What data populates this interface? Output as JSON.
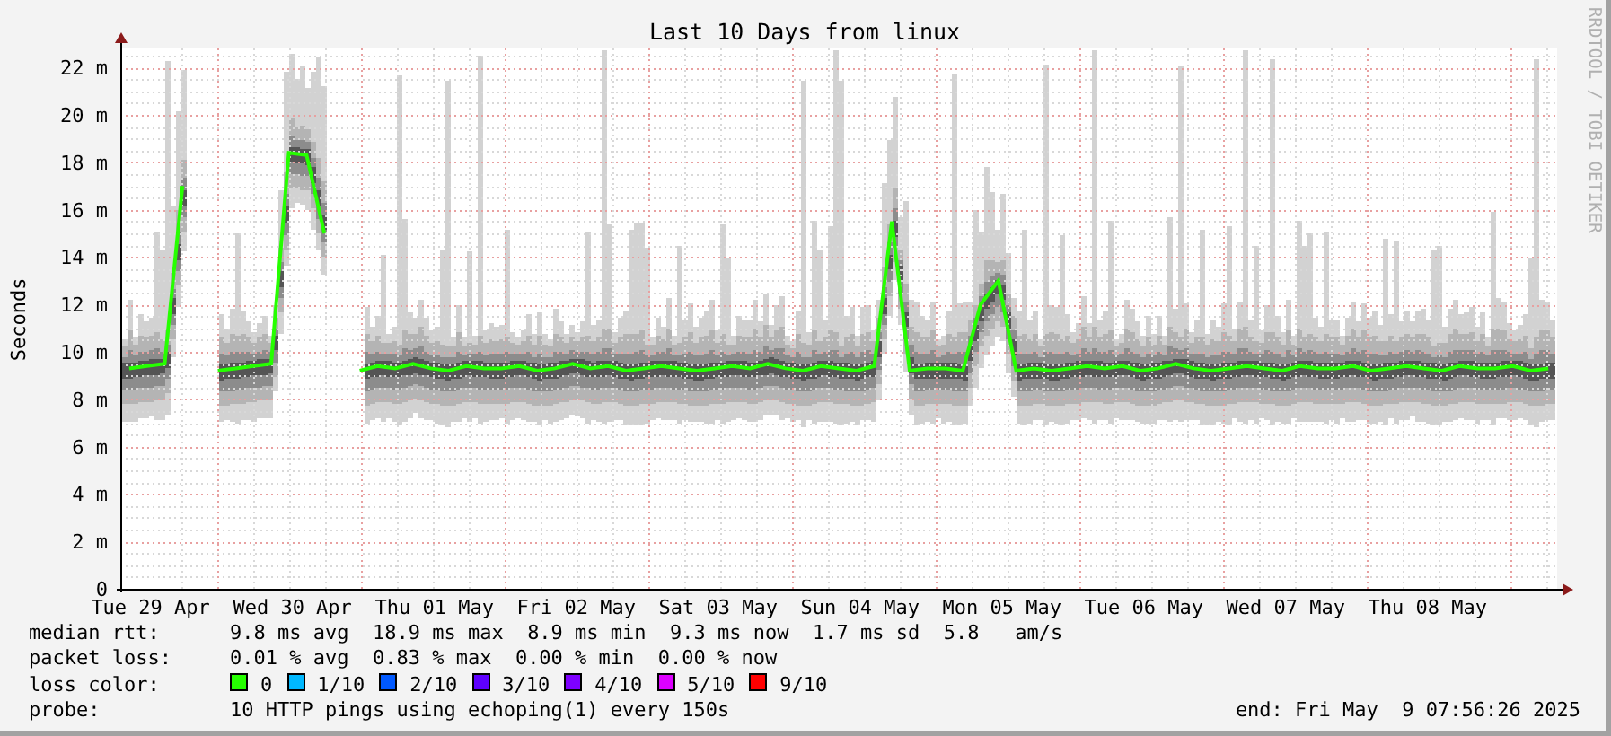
{
  "graph": {
    "credit": "RRDTOOL / TOBI OETIKER",
    "chart_data": {
      "type": "line",
      "title": "Last 10 Days from linux",
      "ylabel": "Seconds",
      "categories": [
        null,
        "Tue 29 Apr",
        null,
        null,
        null,
        null,
        null,
        null,
        null,
        "Wed 30 Apr",
        null,
        null,
        null,
        null,
        null,
        null,
        null,
        "Thu 01 May",
        null,
        null,
        null,
        null,
        null,
        null,
        null,
        "Fri 02 May",
        null,
        null,
        null,
        null,
        null,
        null,
        null,
        "Sat 03 May",
        null,
        null,
        null,
        null,
        null,
        null,
        null,
        "Sun 04 May",
        null,
        null,
        null,
        null,
        null,
        null,
        null,
        "Mon 05 May",
        null,
        null,
        null,
        null,
        null,
        null,
        null,
        "Tue 06 May",
        null,
        null,
        null,
        null,
        null,
        null,
        null,
        "Wed 07 May",
        null,
        null,
        null,
        null,
        null,
        null,
        null,
        "Thu 08 May",
        null,
        null,
        null,
        null,
        null,
        null,
        null
      ],
      "series": [
        {
          "name": "median rtt:",
          "color": "#26ff00",
          "values": [
            9.3,
            9.4,
            9.5,
            17.0,
            null,
            9.2,
            9.3,
            9.4,
            9.5,
            18.4,
            18.3,
            15.0,
            null,
            9.2,
            9.4,
            9.3,
            9.5,
            9.3,
            9.2,
            9.4,
            9.3,
            9.3,
            9.4,
            9.2,
            9.3,
            9.5,
            9.3,
            9.4,
            9.2,
            9.3,
            9.4,
            9.3,
            9.2,
            9.3,
            9.4,
            9.3,
            9.5,
            9.3,
            9.2,
            9.4,
            9.3,
            9.2,
            9.4,
            15.5,
            9.2,
            9.3,
            9.3,
            9.2,
            12.0,
            13.0,
            9.2,
            9.3,
            9.2,
            9.3,
            9.4,
            9.3,
            9.4,
            9.2,
            9.3,
            9.5,
            9.3,
            9.2,
            9.3,
            9.4,
            9.3,
            9.2,
            9.4,
            9.3,
            9.3,
            9.4,
            9.2,
            9.3,
            9.4,
            9.3,
            9.2,
            9.4,
            9.3,
            9.3,
            9.4,
            9.2,
            9.3
          ]
        }
      ],
      "ylim": [
        0,
        22.8
      ],
      "grid": true,
      "yticks": [
        {
          "value": 0,
          "label": "0"
        },
        {
          "value": 2,
          "label": "2 m"
        },
        {
          "value": 4,
          "label": "4 m"
        },
        {
          "value": 6,
          "label": "6 m"
        },
        {
          "value": 8,
          "label": "8 m"
        },
        {
          "value": 10,
          "label": "10 m"
        },
        {
          "value": 12,
          "label": "12 m"
        },
        {
          "value": 14,
          "label": "14 m"
        },
        {
          "value": 16,
          "label": "16 m"
        },
        {
          "value": 18,
          "label": "18 m"
        },
        {
          "value": 20,
          "label": "20 m"
        },
        {
          "value": 22,
          "label": "22 m"
        }
      ]
    }
  },
  "legend": {
    "median_rtt": {
      "text": "9.8 ms avg  18.9 ms max  8.9 ms min  9.3 ms now  1.7 ms sd  5.8   am/s"
    },
    "packet_loss": {
      "label": "packet loss:",
      "text": "0.01 % avg  0.83 % max  0.00 % min  0.00 % now"
    },
    "loss_color": {
      "label": "loss color:",
      "items": [
        {
          "label": "0",
          "color": "#26ff00"
        },
        {
          "label": "1/10",
          "color": "#00b8ff"
        },
        {
          "label": "2/10",
          "color": "#0059ff"
        },
        {
          "label": "3/10",
          "color": "#5e00ff"
        },
        {
          "label": "4/10",
          "color": "#7e00ff"
        },
        {
          "label": "5/10",
          "color": "#dd00ff"
        },
        {
          "label": "9/10",
          "color": "#ff0000"
        }
      ]
    },
    "probe": {
      "label": "probe:",
      "text": "10 HTTP pings using echoping(1) every 150s"
    },
    "end": "end: Fri May  9 07:56:26 2025"
  }
}
